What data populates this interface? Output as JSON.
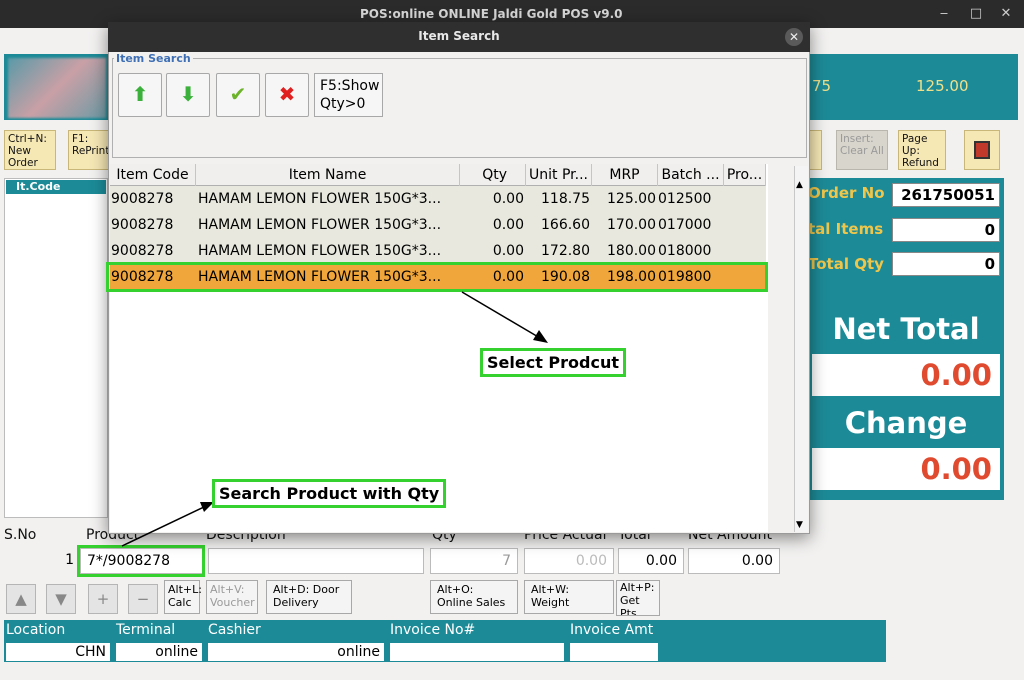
{
  "main_window": {
    "title": "POS:online    ONLINE Jaldi Gold POS v9.0"
  },
  "header": {
    "value_left": "75",
    "value_right": "125.00"
  },
  "toolbar": {
    "new_order": "Ctrl+N: New Order",
    "reprint": "F1: RePrint",
    "clear_all": "Insert: Clear All",
    "refund": "Page Up: Refund"
  },
  "left_list": {
    "header": "It.Code"
  },
  "right_panel": {
    "order_no_label": "Order No",
    "order_no": "261750051",
    "total_items_label": "tal Items",
    "total_items": "0",
    "total_qty_label": "Total Qty",
    "total_qty": "0",
    "net_total_label": "Net Total",
    "net_total": "0.00",
    "change_label": "Change",
    "change": "0.00"
  },
  "entry": {
    "sno_label": "S.No",
    "product_label": "Product",
    "description_label": "Description",
    "qty_label": "Qty",
    "price_label": "Price Actual",
    "total_label": "Total",
    "net_amount_label": "Net Amount",
    "sno": "1",
    "product": "7*/9008278",
    "qty": "7",
    "price": "0.00",
    "total": "0.00",
    "net_amount": "0.00"
  },
  "function_buttons": {
    "calc": "Alt+L: Calc",
    "voucher": "Alt+V: Voucher",
    "door_delivery": "Alt+D: Door Delivery",
    "online_sales": "Alt+O: Online Sales",
    "weight": "Alt+W: Weight",
    "get_pts": "Alt+P: Get Pts"
  },
  "status_bar": {
    "location_label": "Location",
    "terminal_label": "Terminal",
    "cashier_label": "Cashier",
    "invoice_no_label": "Invoice No#",
    "invoice_amt_label": "Invoice Amt",
    "location": "CHN",
    "terminal": "online",
    "cashier": "online",
    "invoice_no": "",
    "invoice_amt": ""
  },
  "modal": {
    "title": "Item Search",
    "group_label": "Item Search",
    "f5_button": "F5:Show Qty>0",
    "columns": [
      "Item Code",
      "Item Name",
      "Qty",
      "Unit Pr...",
      "MRP",
      "Batch ...",
      "Pro..."
    ],
    "rows": [
      {
        "code": "9008278",
        "name": "HAMAM LEMON FLOWER 150G*3...",
        "qty": "0.00",
        "unit_price": "118.75",
        "mrp": "125.00",
        "batch": "012500",
        "pro": ""
      },
      {
        "code": "9008278",
        "name": "HAMAM LEMON FLOWER 150G*3...",
        "qty": "0.00",
        "unit_price": "166.60",
        "mrp": "170.00",
        "batch": "017000",
        "pro": ""
      },
      {
        "code": "9008278",
        "name": "HAMAM LEMON FLOWER 150G*3...",
        "qty": "0.00",
        "unit_price": "172.80",
        "mrp": "180.00",
        "batch": "018000",
        "pro": ""
      },
      {
        "code": "9008278",
        "name": "HAMAM LEMON FLOWER 150G*3...",
        "qty": "0.00",
        "unit_price": "190.08",
        "mrp": "198.00",
        "batch": "019800",
        "pro": ""
      }
    ]
  },
  "annotations": {
    "select_product": "Select Prodcut",
    "search_product": "Search Product with Qty"
  },
  "colors": {
    "teal": "#1c8b97",
    "selected_row": "#f0a63a",
    "highlight": "#35d12e",
    "money": "#e04a2e"
  },
  "icons": [
    "up-arrow-icon",
    "down-arrow-icon",
    "check-icon",
    "cross-icon",
    "exit-icon"
  ]
}
